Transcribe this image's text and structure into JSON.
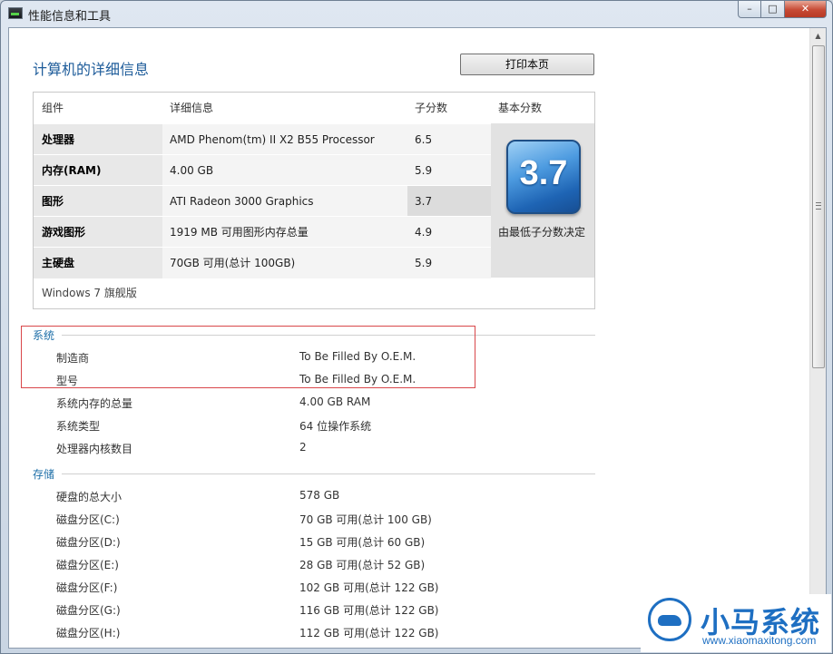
{
  "window": {
    "title": "性能信息和工具",
    "controls": {
      "minimize": "–",
      "maximize": "□",
      "close": "✕"
    }
  },
  "page": {
    "title": "计算机的详细信息",
    "print_label": "打印本页"
  },
  "score_table": {
    "headers": {
      "component": "组件",
      "details": "详细信息",
      "subscore": "子分数",
      "base": "基本分数"
    },
    "rows": [
      {
        "component": "处理器",
        "details": "AMD Phenom(tm) II X2 B55 Processor",
        "subscore": "6.5"
      },
      {
        "component": "内存(RAM)",
        "details": "4.00 GB",
        "subscore": "5.9"
      },
      {
        "component": "图形",
        "details": "ATI Radeon 3000 Graphics",
        "subscore": "3.7"
      },
      {
        "component": "游戏图形",
        "details": "1919 MB 可用图形内存总量",
        "subscore": "4.9"
      },
      {
        "component": "主硬盘",
        "details": "70GB 可用(总计 100GB)",
        "subscore": "5.9"
      }
    ],
    "base_score": "3.7",
    "base_label": "由最低子分数决定",
    "edition": "Windows 7 旗舰版"
  },
  "system": {
    "title": "系统",
    "items": [
      {
        "label": "制造商",
        "value": "To Be Filled By O.E.M."
      },
      {
        "label": "型号",
        "value": "To Be Filled By O.E.M."
      },
      {
        "label": "系统内存的总量",
        "value": "4.00 GB RAM"
      },
      {
        "label": "系统类型",
        "value": "64 位操作系统"
      },
      {
        "label": "处理器内核数目",
        "value": "2"
      }
    ]
  },
  "storage": {
    "title": "存储",
    "items": [
      {
        "label": "硬盘的总大小",
        "value": "578 GB"
      },
      {
        "label": "磁盘分区(C:)",
        "value": "70 GB 可用(总计 100 GB)"
      },
      {
        "label": "磁盘分区(D:)",
        "value": "15 GB 可用(总计 60 GB)"
      },
      {
        "label": "磁盘分区(E:)",
        "value": "28 GB 可用(总计 52 GB)"
      },
      {
        "label": "磁盘分区(F:)",
        "value": "102 GB 可用(总计 122 GB)"
      },
      {
        "label": "磁盘分区(G:)",
        "value": "116 GB 可用(总计 122 GB)"
      },
      {
        "label": "磁盘分区(H:)",
        "value": "112 GB 可用(总计 122 GB)"
      }
    ]
  },
  "watermark": {
    "title": "小马系统",
    "url": "www.xiaomaxitong.com"
  },
  "colors": {
    "accent": "#1e5c9a",
    "section": "#1e6fa8",
    "highlight_border": "#d9474a",
    "badge": "#1e64b4"
  }
}
